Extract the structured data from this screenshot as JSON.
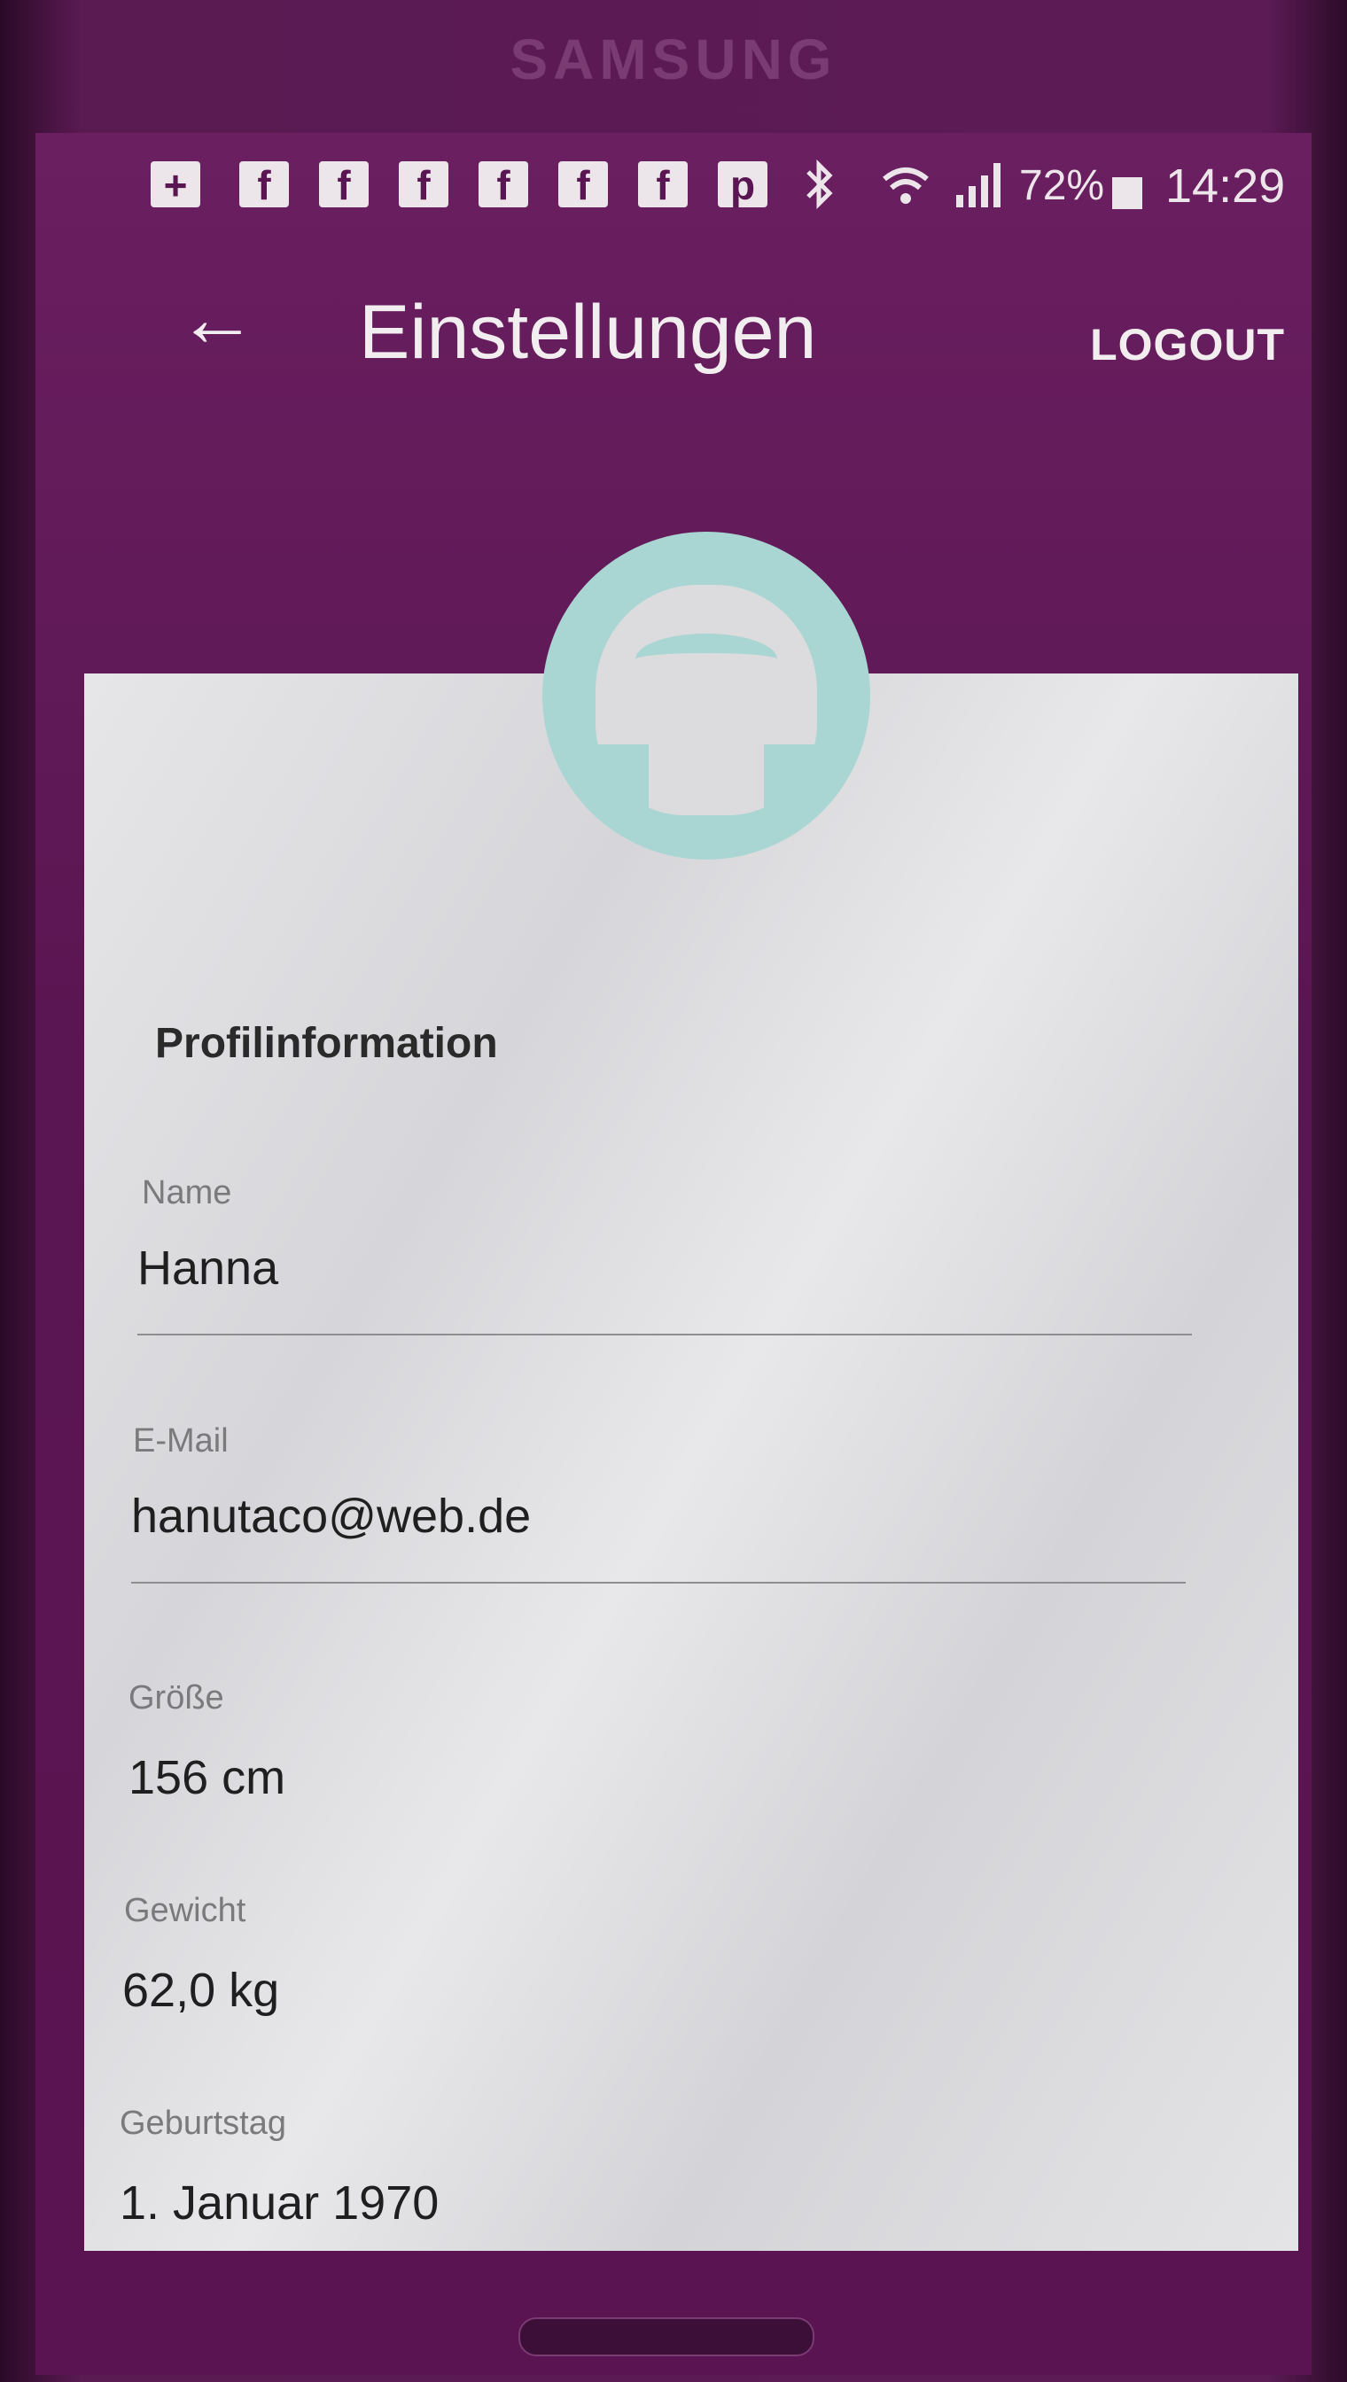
{
  "device": {
    "brand": "SAMSUNG"
  },
  "status_bar": {
    "notification_icons": [
      "mail-plus-icon",
      "facebook-icon",
      "facebook-icon",
      "facebook-icon",
      "facebook-icon",
      "facebook-icon",
      "facebook-icon",
      "chat-icon"
    ],
    "bluetooth_icon": "bluetooth-icon",
    "wifi_icon": "wifi-icon",
    "signal_icon": "signal-icon",
    "battery_percent": "72%",
    "battery_icon": "battery-icon",
    "time": "14:29"
  },
  "app_bar": {
    "back_icon": "arrow-left-icon",
    "title": "Einstellungen",
    "logout_label": "LOGOUT"
  },
  "profile": {
    "avatar_icon": "user-avatar-icon",
    "section_title": "Profilinformation",
    "fields": [
      {
        "label": "Name",
        "value": "Hanna"
      },
      {
        "label": "E-Mail",
        "value": "hanutaco@web.de"
      },
      {
        "label": "Größe",
        "value": "156 cm"
      },
      {
        "label": "Gewicht",
        "value": "62,0 kg"
      },
      {
        "label": "Geburtstag",
        "value": "1. Januar 1970"
      }
    ]
  },
  "colors": {
    "app_background": "#5a1652",
    "card_background": "#e4e4e6",
    "avatar_accent": "#a9d6d2",
    "text_on_dark": "#f2eef0"
  }
}
